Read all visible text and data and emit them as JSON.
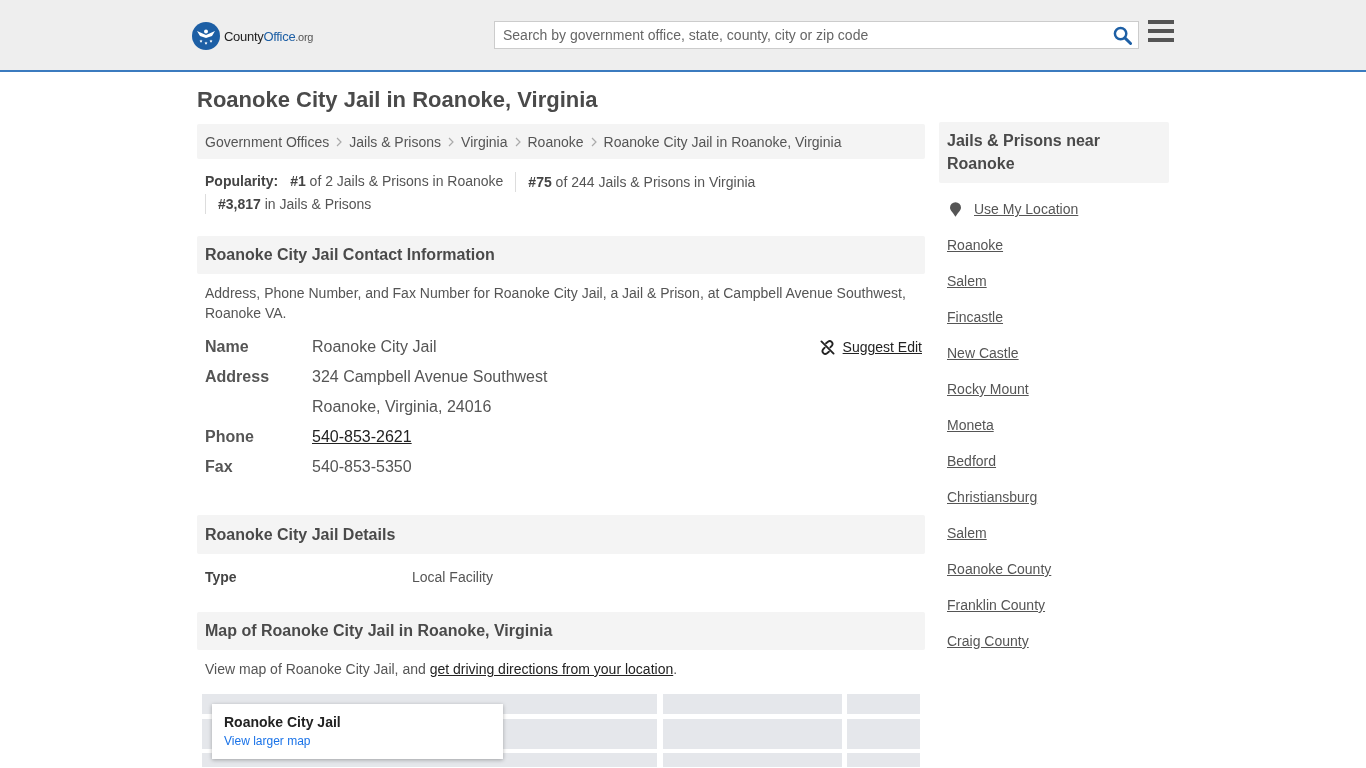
{
  "header": {
    "logo": [
      {
        "text": "County",
        "kind": "plain"
      },
      {
        "text": "Office",
        "kind": "accent"
      },
      {
        "text": ".org",
        "kind": "small"
      }
    ],
    "search": {
      "placeholder": "Search by government office, state, county, city or zip code"
    }
  },
  "page_title": "Roanoke City Jail in Roanoke, Virginia",
  "breadcrumbs": [
    "Government Offices",
    "Jails & Prisons",
    "Virginia",
    "Roanoke",
    "Roanoke City Jail in Roanoke, Virginia"
  ],
  "popularity": {
    "label": "Popularity:",
    "ranks": [
      "**#1** of 2 Jails & Prisons in Roanoke",
      "**#75** of 244 Jails & Prisons in Virginia",
      "**#3,817** in Jails & Prisons"
    ]
  },
  "contact": {
    "heading": "Roanoke City Jail Contact Information",
    "description": "Address, Phone Number, and Fax Number for Roanoke City Jail, a Jail & Prison, at Campbell Avenue Southwest, Roanoke VA.",
    "suggest_edit": "Suggest Edit",
    "fields": [
      {
        "label": "Name",
        "kind": "text",
        "values": [
          "Roanoke City Jail"
        ]
      },
      {
        "label": "Address",
        "kind": "text",
        "values": [
          "324 Campbell Avenue Southwest",
          "Roanoke, Virginia, 24016"
        ]
      },
      {
        "label": "Phone",
        "kind": "link",
        "values": [
          "540-853-2621"
        ]
      },
      {
        "label": "Fax",
        "kind": "text",
        "values": [
          "540-853-5350"
        ]
      }
    ]
  },
  "details": {
    "heading": "Roanoke City Jail Details",
    "rows": [
      {
        "label": "Type",
        "value": "Local Facility"
      }
    ]
  },
  "map": {
    "heading": "Map of Roanoke City Jail in Roanoke, Virginia",
    "intro": "View map of Roanoke City Jail, and ",
    "directions_link": "get driving directions from your location",
    "intro_end": ".",
    "card": {
      "title": "Roanoke City Jail",
      "link": "View larger map"
    }
  },
  "sidebar": {
    "heading": "Jails & Prisons near Roanoke",
    "location_link": "Use My Location",
    "links": [
      "Roanoke",
      "Salem",
      "Fincastle",
      "New Castle",
      "Rocky Mount",
      "Moneta",
      "Bedford",
      "Christiansburg",
      "Salem",
      "Roanoke County",
      "Franklin County",
      "Craig County"
    ]
  }
}
